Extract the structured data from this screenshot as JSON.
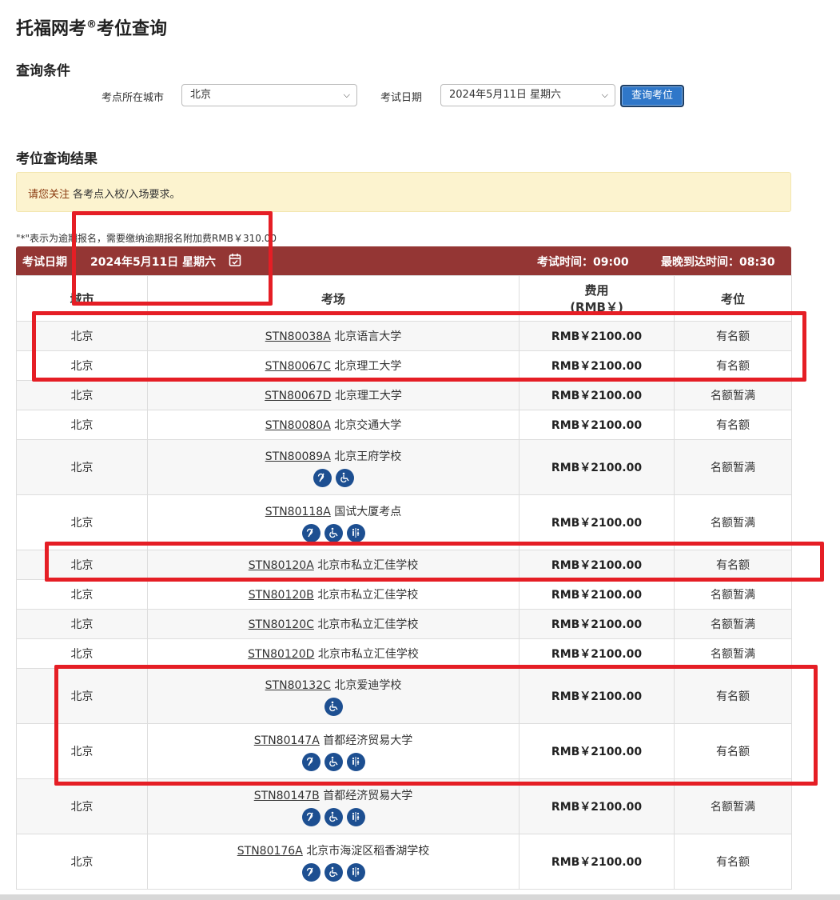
{
  "title": {
    "main": "托福网考",
    "sup": "®",
    "suffix": "考位查询"
  },
  "query": {
    "section_title": "查询条件",
    "city_label": "考点所在城市",
    "city_value": "北京",
    "date_label": "考试日期",
    "date_value": "2024年5月11日 星期六",
    "search_button": "查询考位"
  },
  "results": {
    "section_title": "考位查询结果",
    "alert_highlight": "请您关注",
    "alert_text": " 各考点入校/入场要求。",
    "note": "\"*\"表示为逾期报名，需要缴纳逾期报名附加费RMB￥310.00"
  },
  "table": {
    "bar": {
      "date_label": "考试日期",
      "date_value": "2024年5月11日 星期六",
      "exam_time": "考试时间：09:00",
      "latest_arrival": "最晚到达时间：08:30"
    },
    "headers": {
      "city": "城市",
      "venue": "考场",
      "fee": "费用",
      "fee_unit": "(RMB￥)",
      "seat": "考位"
    },
    "rows": [
      {
        "city": "北京",
        "code": "STN80038A",
        "name": "北京语言大学",
        "fee": "RMB￥2100.00",
        "seat": "有名额",
        "icons": []
      },
      {
        "city": "北京",
        "code": "STN80067C",
        "name": "北京理工大学",
        "fee": "RMB￥2100.00",
        "seat": "有名额",
        "icons": []
      },
      {
        "city": "北京",
        "code": "STN80067D",
        "name": "北京理工大学",
        "fee": "RMB￥2100.00",
        "seat": "名额暂满",
        "icons": []
      },
      {
        "city": "北京",
        "code": "STN80080A",
        "name": "北京交通大学",
        "fee": "RMB￥2100.00",
        "seat": "有名额",
        "icons": []
      },
      {
        "city": "北京",
        "code": "STN80089A",
        "name": "北京王府学校",
        "fee": "RMB￥2100.00",
        "seat": "名额暂满",
        "icons": [
          "hearing-icon",
          "wheelchair-icon"
        ]
      },
      {
        "city": "北京",
        "code": "STN80118A",
        "name": "国试大厦考点",
        "fee": "RMB￥2100.00",
        "seat": "名额暂满",
        "icons": [
          "hearing-icon",
          "wheelchair-icon",
          "restroom-icon"
        ]
      },
      {
        "city": "北京",
        "code": "STN80120A",
        "name": "北京市私立汇佳学校",
        "fee": "RMB￥2100.00",
        "seat": "有名额",
        "icons": []
      },
      {
        "city": "北京",
        "code": "STN80120B",
        "name": "北京市私立汇佳学校",
        "fee": "RMB￥2100.00",
        "seat": "名额暂满",
        "icons": []
      },
      {
        "city": "北京",
        "code": "STN80120C",
        "name": "北京市私立汇佳学校",
        "fee": "RMB￥2100.00",
        "seat": "名额暂满",
        "icons": []
      },
      {
        "city": "北京",
        "code": "STN80120D",
        "name": "北京市私立汇佳学校",
        "fee": "RMB￥2100.00",
        "seat": "名额暂满",
        "icons": []
      },
      {
        "city": "北京",
        "code": "STN80132C",
        "name": "北京爱迪学校",
        "fee": "RMB￥2100.00",
        "seat": "有名额",
        "icons": [
          "wheelchair-icon"
        ]
      },
      {
        "city": "北京",
        "code": "STN80147A",
        "name": "首都经济贸易大学",
        "fee": "RMB￥2100.00",
        "seat": "有名额",
        "icons": [
          "hearing-icon",
          "wheelchair-icon",
          "restroom-icon"
        ]
      },
      {
        "city": "北京",
        "code": "STN80147B",
        "name": "首都经济贸易大学",
        "fee": "RMB￥2100.00",
        "seat": "名额暂满",
        "icons": [
          "hearing-icon",
          "wheelchair-icon",
          "restroom-icon"
        ]
      },
      {
        "city": "北京",
        "code": "STN80176A",
        "name": "北京市海淀区稻香湖学校",
        "fee": "RMB￥2100.00",
        "seat": "有名额",
        "icons": [
          "hearing-icon",
          "wheelchair-icon",
          "restroom-icon"
        ]
      }
    ]
  },
  "colors": {
    "header_bar": "#943634",
    "annotation_red": "#e51e25",
    "icon_blue": "#1d4f91",
    "button_blue": "#2f77c9"
  }
}
